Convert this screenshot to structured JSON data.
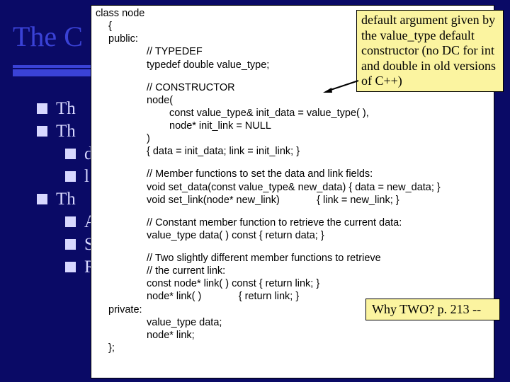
{
  "title": "The C",
  "bullets": {
    "b1": "Th",
    "b2": "Th",
    "s1": "d",
    "s2": "l",
    "b3": "Th",
    "s3": "A",
    "s4": "S",
    "s5": "R"
  },
  "code": {
    "l1": "class node",
    "l2": "{",
    "l3": "public:",
    "l4": "// TYPEDEF",
    "l5": "typedef double value_type;",
    "l6": "// CONSTRUCTOR",
    "l7": "node(",
    "l8": "const value_type& init_data = value_type( ),",
    "l9": "node* init_link = NULL",
    "l10": ")",
    "l11": "{ data = init_data; link = init_link; }",
    "l12": "// Member functions to set the data and link fields:",
    "l13": "void set_data(const value_type& new_data) { data = new_data; }",
    "l14": "void set_link(node* new_link)             { link = new_link; }",
    "l15": "// Constant member function to retrieve the current data:",
    "l16": "value_type data( ) const { return data; }",
    "l17": "// Two slightly different member functions to retrieve",
    "l18": "// the current link:",
    "l19": "const node* link( ) const { return link; }",
    "l20": "node* link( )             { return link; }",
    "l21": "private:",
    "l22": "value_type data;",
    "l23": "node* link;",
    "l24": "};"
  },
  "callout1": "default argument given by the value_type default constructor (no DC for int and double in old versions of C++)",
  "callout2": "Why TWO? p. 213 --"
}
